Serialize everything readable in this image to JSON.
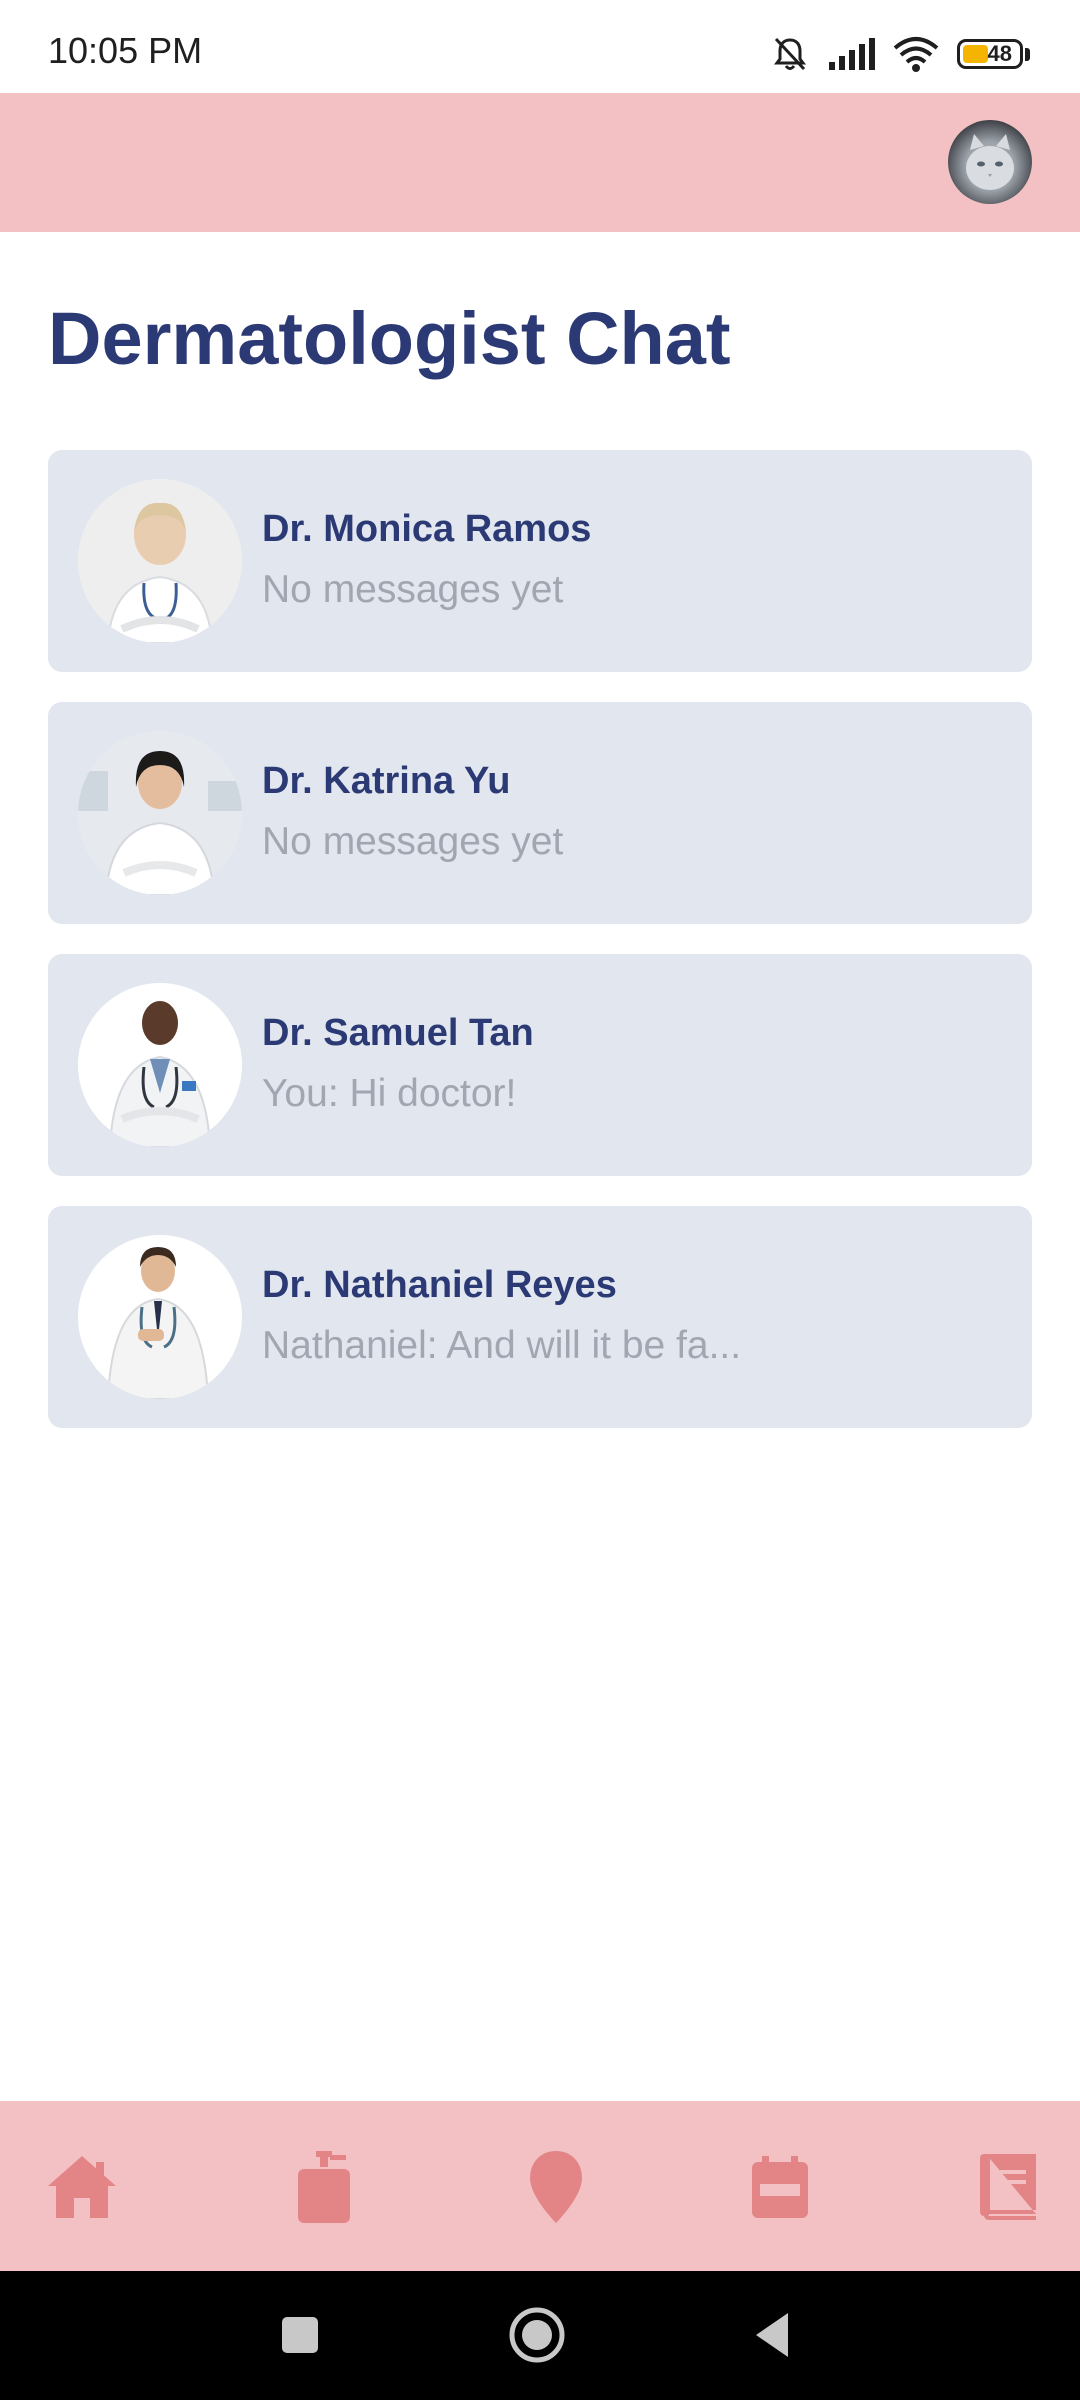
{
  "status_bar": {
    "time": "10:05 PM",
    "battery_level": "48",
    "icons": [
      "mute-bell-icon",
      "signal-icon",
      "wifi-icon",
      "battery-icon"
    ]
  },
  "header": {
    "profile_avatar": "cat-avatar"
  },
  "page": {
    "title": "Dermatologist Chat"
  },
  "chats": [
    {
      "name": "Dr. Monica Ramos",
      "preview": "No messages yet"
    },
    {
      "name": "Dr. Katrina Yu",
      "preview": "No messages yet"
    },
    {
      "name": "Dr. Samuel Tan",
      "preview": "You: Hi doctor!"
    },
    {
      "name": "Dr. Nathaniel Reyes",
      "preview": "Nathaniel: And will it be fa..."
    }
  ],
  "bottom_nav": {
    "items": [
      "home-icon",
      "soap-bottle-icon",
      "location-pin-icon",
      "calendar-icon",
      "book-icon"
    ]
  },
  "colors": {
    "accent_header": "#f3c1c4",
    "nav_icon": "#e38487",
    "title_text": "#2b3a74",
    "card_bg": "#e1e6ef",
    "preview_text": "#a1a6b1"
  }
}
